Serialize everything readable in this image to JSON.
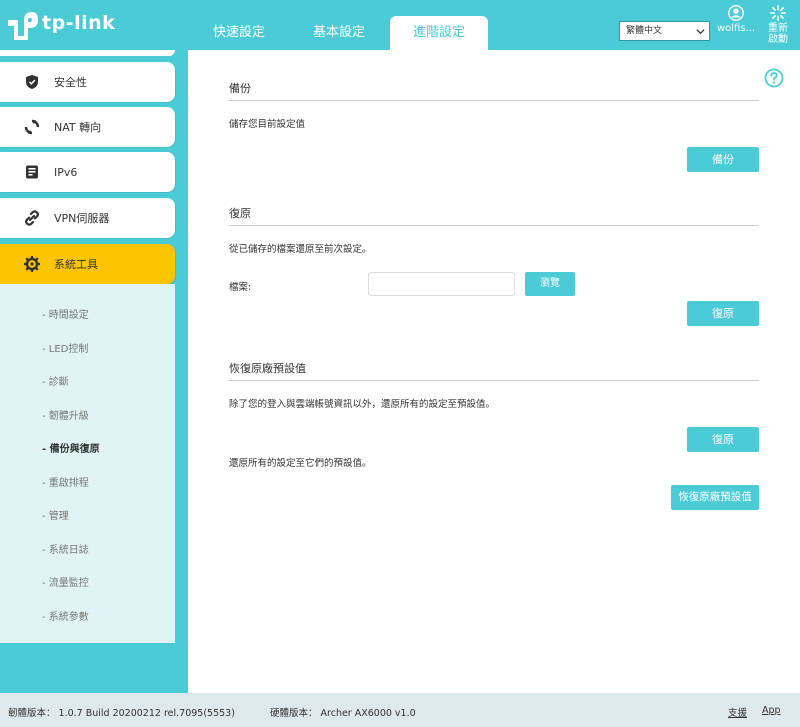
{
  "header": {
    "brand": "tp-link",
    "tabs": [
      {
        "label": "快速設定",
        "active": false
      },
      {
        "label": "基本設定",
        "active": false
      },
      {
        "label": "進階設定",
        "active": true
      }
    ],
    "language": "繁體中文",
    "user_label": "wolfis...",
    "reboot_label": "重新啟動"
  },
  "sidebar": {
    "items": [
      {
        "label": "安全性",
        "icon": "shield-icon"
      },
      {
        "label": "NAT 轉向",
        "icon": "nat-icon"
      },
      {
        "label": "IPv6",
        "icon": "ipv6-icon"
      },
      {
        "label": "VPN伺服器",
        "icon": "vpn-icon"
      },
      {
        "label": "系統工具",
        "icon": "gear-icon",
        "active": true
      }
    ],
    "subitems": [
      {
        "label": "- 時間設定"
      },
      {
        "label": "- LED控制"
      },
      {
        "label": "- 診斷"
      },
      {
        "label": "- 韌體升級"
      },
      {
        "label": "- 備份與復原",
        "active": true
      },
      {
        "label": "- 重啟排程"
      },
      {
        "label": "- 管理"
      },
      {
        "label": "- 系統日誌"
      },
      {
        "label": "- 流量監控"
      },
      {
        "label": "- 系統參數"
      }
    ]
  },
  "main": {
    "backup": {
      "title": "備份",
      "description": "儲存您目前設定值",
      "button": "備份"
    },
    "restore": {
      "title": "復原",
      "description": "從已儲存的檔案還原至前次設定。",
      "file_label": "檔案:",
      "file_value": "",
      "browse_button": "瀏覽",
      "button": "復原"
    },
    "factory": {
      "title": "恢復原廠預設值",
      "description1": "除了您的登入與雲端帳號資訊以外，還原所有的設定至預設值。",
      "button1": "復原",
      "description2": "還原所有的設定至它們的預設值。",
      "button2": "恢復原廠預設值"
    }
  },
  "footer": {
    "firmware": "韌體版本： 1.0.7 Build 20200212 rel.7095(5553)",
    "hardware": "硬體版本： Archer AX6000 v1.0",
    "support": "支援",
    "app": "App"
  },
  "colors": {
    "accent": "#4acbd6",
    "active_menu": "#fcc500",
    "submenu_bg": "#e0f4f6"
  }
}
